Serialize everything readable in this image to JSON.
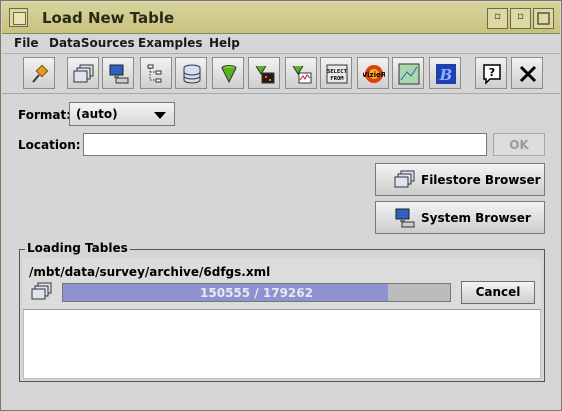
{
  "window": {
    "title": "Load New Table",
    "controls": [
      "minimize-icon",
      "maximize-icon",
      "close-icon"
    ]
  },
  "menubar": {
    "items": [
      "File",
      "DataSources",
      "Examples",
      "Help"
    ]
  },
  "toolbar": {
    "tools": [
      {
        "icon": "pin-icon"
      },
      {
        "icon": "filestore-icon"
      },
      {
        "icon": "system-browser-icon"
      },
      {
        "icon": "tree-hierarchy-icon"
      },
      {
        "icon": "database-icon"
      },
      {
        "icon": "cone-search-icon"
      },
      {
        "icon": "siap-icon"
      },
      {
        "icon": "ssap-icon"
      },
      {
        "icon": "select-from-icon",
        "text": "SELECT FROM"
      },
      {
        "icon": "vizier-icon",
        "text": "VizieR"
      },
      {
        "icon": "sky-map-icon"
      },
      {
        "icon": "bookmark-b-icon"
      },
      {
        "icon": "help-icon",
        "text": "?"
      },
      {
        "icon": "close-window-icon"
      }
    ]
  },
  "form": {
    "format_label": "Format:",
    "format_value": "(auto)",
    "location_label": "Location:",
    "location_value": "",
    "ok_label": "OK",
    "filestore_label": "Filestore Browser",
    "system_label": "System Browser"
  },
  "loading": {
    "title": "Loading Tables",
    "path": "/mbt/data/survey/archive/6dfgs.xml",
    "progress_text": "150555 / 179262",
    "progress_fraction": 0.8399,
    "cancel_label": "Cancel"
  },
  "colors": {
    "titlebar": "#d0cb8e",
    "progress_fill": "#8e93cf",
    "background": "#d6d6d6"
  }
}
